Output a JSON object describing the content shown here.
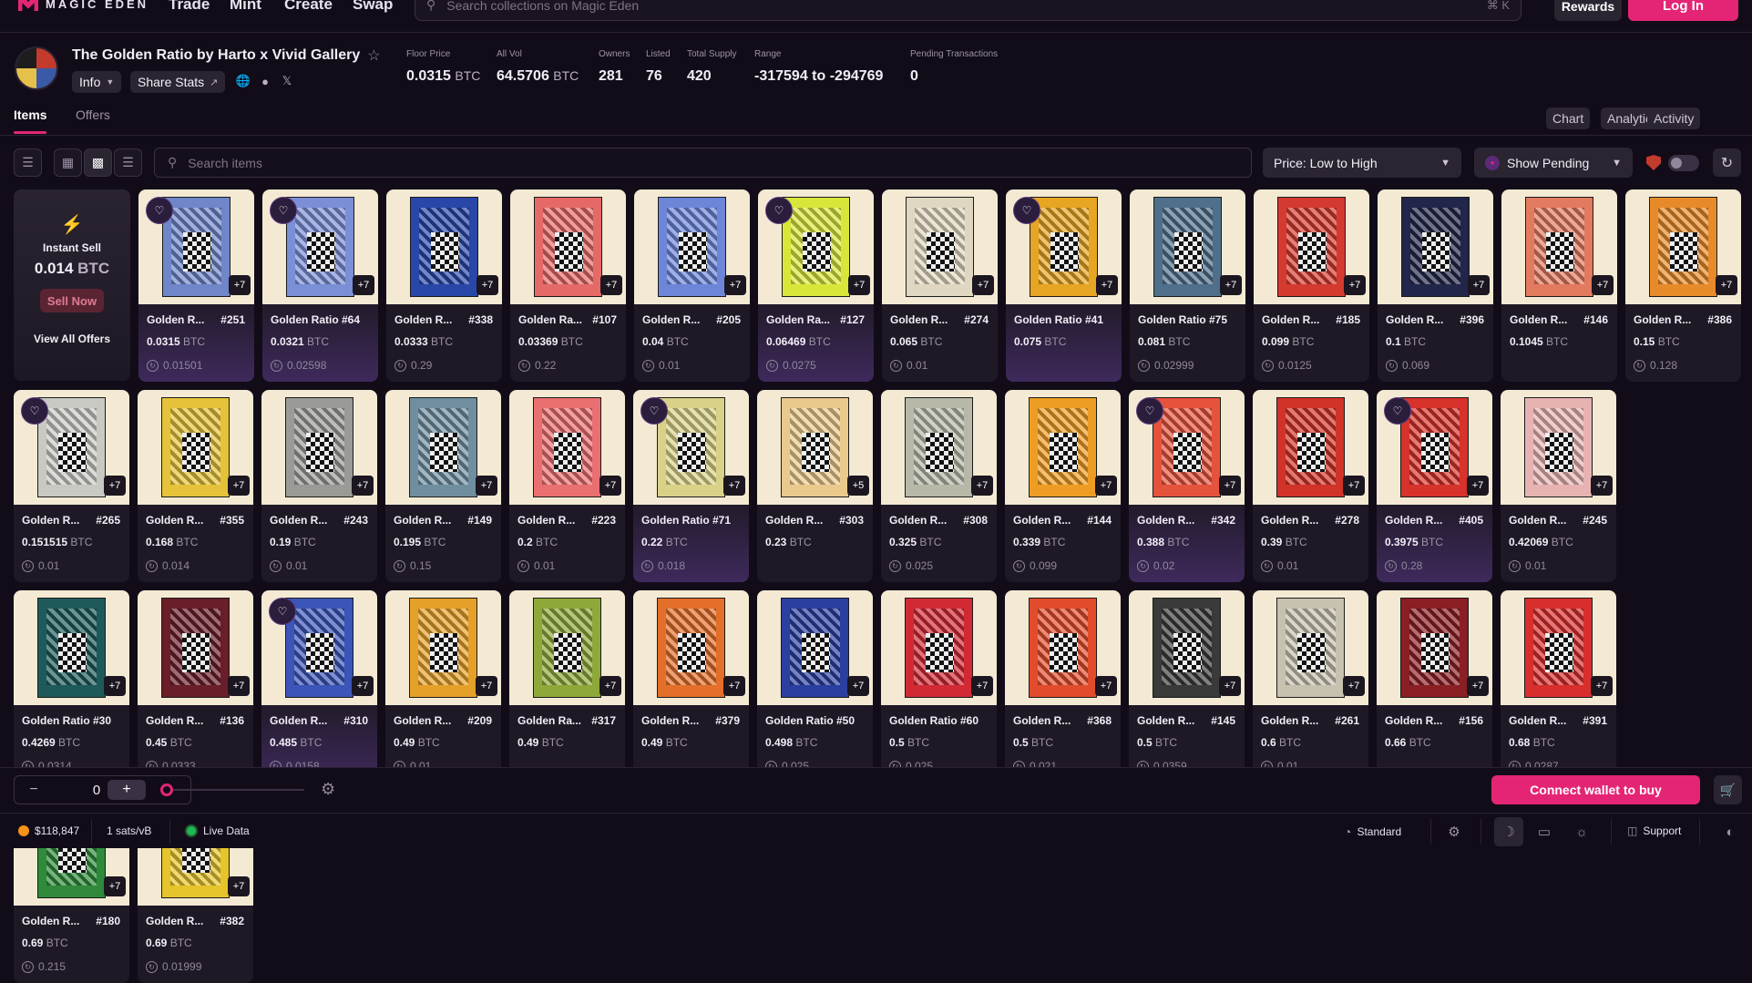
{
  "topnav": {
    "logo": "MAGIC EDEN",
    "links": [
      "Trade",
      "Mint",
      "Create",
      "Swap"
    ],
    "search_placeholder": "Search collections on Magic Eden",
    "search_shortcut": "⌘ K",
    "rewards": "Rewards",
    "login": "Log In"
  },
  "collection": {
    "title": "The Golden Ratio by Harto x Vivid Gallery",
    "info": "Info",
    "share_stats": "Share Stats",
    "stats": [
      {
        "label": "Floor Price",
        "value": "0.0315",
        "unit": "BTC"
      },
      {
        "label": "All Vol",
        "value": "64.5706",
        "unit": "BTC"
      },
      {
        "label": "Owners",
        "value": "281",
        "unit": ""
      },
      {
        "label": "Listed",
        "value": "76",
        "unit": ""
      },
      {
        "label": "Total Supply",
        "value": "420",
        "unit": ""
      },
      {
        "label": "Range",
        "value": "-317594 to -294769",
        "unit": ""
      },
      {
        "label": "Pending Transactions",
        "value": "0",
        "unit": ""
      }
    ]
  },
  "tabs": {
    "items": "Items",
    "offers": "Offers",
    "chart": "Chart",
    "analytics": "Analytics",
    "activity": "Activity"
  },
  "toolbar": {
    "search_placeholder": "Search items",
    "sort": "Price: Low to High",
    "pending": "Show Pending"
  },
  "instant_sell": {
    "title": "Instant Sell",
    "value": "0.014",
    "unit": "BTC",
    "sell_now": "Sell Now",
    "view_all": "View All Offers"
  },
  "cards": [
    {
      "name": "Golden R...",
      "num": "#251",
      "price": "0.0315",
      "last": "0.01501",
      "plus": "+7",
      "fav": true,
      "sel": true,
      "c": "#6f86c9"
    },
    {
      "name": "Golden Ratio #64",
      "num": "",
      "price": "0.0321",
      "last": "0.02598",
      "plus": "+7",
      "fav": true,
      "sel": true,
      "c": "#7b8fd6"
    },
    {
      "name": "Golden R...",
      "num": "#338",
      "price": "0.0333",
      "last": "0.29",
      "plus": "+7",
      "fav": false,
      "sel": false,
      "c": "#2847a8"
    },
    {
      "name": "Golden Ra...",
      "num": "#107",
      "price": "0.03369",
      "last": "0.22",
      "plus": "+7",
      "fav": false,
      "sel": false,
      "c": "#e56a67"
    },
    {
      "name": "Golden R...",
      "num": "#205",
      "price": "0.04",
      "last": "0.01",
      "plus": "+7",
      "fav": false,
      "sel": false,
      "c": "#6d86d8"
    },
    {
      "name": "Golden Ra...",
      "num": "#127",
      "price": "0.06469",
      "last": "0.0275",
      "plus": "+7",
      "fav": true,
      "sel": true,
      "c": "#d8e63a"
    },
    {
      "name": "Golden R...",
      "num": "#274",
      "price": "0.065",
      "last": "0.01",
      "plus": "+7",
      "fav": false,
      "sel": false,
      "c": "#e0d7c0"
    },
    {
      "name": "Golden Ratio #41",
      "num": "",
      "price": "0.075",
      "last": "",
      "plus": "+7",
      "fav": true,
      "sel": true,
      "c": "#e6a522"
    },
    {
      "name": "Golden Ratio #75",
      "num": "",
      "price": "0.081",
      "last": "0.02999",
      "plus": "+7",
      "fav": false,
      "sel": false,
      "c": "#4f6f8a"
    },
    {
      "name": "Golden R...",
      "num": "#185",
      "price": "0.099",
      "last": "0.0125",
      "plus": "+7",
      "fav": false,
      "sel": false,
      "c": "#d43a2f"
    },
    {
      "name": "Golden R...",
      "num": "#396",
      "price": "0.1",
      "last": "0.069",
      "plus": "+7",
      "fav": false,
      "sel": false,
      "c": "#22264a"
    },
    {
      "name": "Golden R...",
      "num": "#146",
      "price": "0.1045",
      "last": "",
      "plus": "+7",
      "fav": false,
      "sel": false,
      "c": "#e27a5f"
    },
    {
      "name": "Golden R...",
      "num": "#386",
      "price": "0.15",
      "last": "0.128",
      "plus": "+7",
      "fav": false,
      "sel": false,
      "c": "#e78b2a"
    },
    {
      "name": "Golden R...",
      "num": "#265",
      "price": "0.151515",
      "last": "0.01",
      "plus": "+7",
      "fav": true,
      "sel": false,
      "c": "#c9c9c4"
    },
    {
      "name": "Golden R...",
      "num": "#355",
      "price": "0.168",
      "last": "0.014",
      "plus": "+7",
      "fav": false,
      "sel": false,
      "c": "#e5c23a"
    },
    {
      "name": "Golden R...",
      "num": "#243",
      "price": "0.19",
      "last": "0.01",
      "plus": "+7",
      "fav": false,
      "sel": false,
      "c": "#9a9a96"
    },
    {
      "name": "Golden R...",
      "num": "#149",
      "price": "0.195",
      "last": "0.15",
      "plus": "+7",
      "fav": false,
      "sel": false,
      "c": "#6f8fa0"
    },
    {
      "name": "Golden R...",
      "num": "#223",
      "price": "0.2",
      "last": "0.01",
      "plus": "+7",
      "fav": false,
      "sel": false,
      "c": "#ea6f70"
    },
    {
      "name": "Golden Ratio #71",
      "num": "",
      "price": "0.22",
      "last": "0.018",
      "plus": "+7",
      "fav": true,
      "sel": true,
      "c": "#d9d187"
    },
    {
      "name": "Golden R...",
      "num": "#303",
      "price": "0.23",
      "last": "",
      "plus": "+5",
      "fav": false,
      "sel": false,
      "c": "#eac98c"
    },
    {
      "name": "Golden R...",
      "num": "#308",
      "price": "0.325",
      "last": "0.025",
      "plus": "+7",
      "fav": false,
      "sel": false,
      "c": "#b7b8a8"
    },
    {
      "name": "Golden R...",
      "num": "#144",
      "price": "0.339",
      "last": "0.099",
      "plus": "+7",
      "fav": false,
      "sel": false,
      "c": "#ee9d24"
    },
    {
      "name": "Golden R...",
      "num": "#342",
      "price": "0.388",
      "last": "0.02",
      "plus": "+7",
      "fav": true,
      "sel": true,
      "c": "#e6533d"
    },
    {
      "name": "Golden R...",
      "num": "#278",
      "price": "0.39",
      "last": "0.01",
      "plus": "+7",
      "fav": false,
      "sel": false,
      "c": "#d13328"
    },
    {
      "name": "Golden R...",
      "num": "#405",
      "price": "0.3975",
      "last": "0.28",
      "plus": "+7",
      "fav": true,
      "sel": true,
      "c": "#d7322b"
    },
    {
      "name": "Golden R...",
      "num": "#245",
      "price": "0.42069",
      "last": "0.01",
      "plus": "+7",
      "fav": false,
      "sel": false,
      "c": "#e7b3b2"
    },
    {
      "name": "Golden Ratio #30",
      "num": "",
      "price": "0.4269",
      "last": "0.0314",
      "plus": "+7",
      "fav": false,
      "sel": false,
      "c": "#1f5a5a"
    },
    {
      "name": "Golden R...",
      "num": "#136",
      "price": "0.45",
      "last": "0.0333",
      "plus": "+7",
      "fav": false,
      "sel": false,
      "c": "#6a1e2a"
    },
    {
      "name": "Golden R...",
      "num": "#310",
      "price": "0.485",
      "last": "0.0158",
      "plus": "+7",
      "fav": true,
      "sel": true,
      "c": "#3b55b8"
    },
    {
      "name": "Golden R...",
      "num": "#209",
      "price": "0.49",
      "last": "0.01",
      "plus": "+7",
      "fav": false,
      "sel": false,
      "c": "#e5a029"
    },
    {
      "name": "Golden Ra...",
      "num": "#317",
      "price": "0.49",
      "last": "",
      "plus": "+7",
      "fav": false,
      "sel": false,
      "c": "#8fa83a"
    },
    {
      "name": "Golden R...",
      "num": "#379",
      "price": "0.49",
      "last": "",
      "plus": "+7",
      "fav": false,
      "sel": false,
      "c": "#e36f2a"
    },
    {
      "name": "Golden Ratio #50",
      "num": "",
      "price": "0.498",
      "last": "0.025",
      "plus": "+7",
      "fav": false,
      "sel": false,
      "c": "#2b3fa0"
    },
    {
      "name": "Golden Ratio #60",
      "num": "",
      "price": "0.5",
      "last": "0.025",
      "plus": "+7",
      "fav": false,
      "sel": false,
      "c": "#d12a35"
    },
    {
      "name": "Golden R...",
      "num": "#368",
      "price": "0.5",
      "last": "0.021",
      "plus": "+7",
      "fav": false,
      "sel": false,
      "c": "#e24c2c"
    },
    {
      "name": "Golden R...",
      "num": "#145",
      "price": "0.5",
      "last": "0.0359",
      "plus": "+7",
      "fav": false,
      "sel": false,
      "c": "#3a3a3a"
    },
    {
      "name": "Golden R...",
      "num": "#261",
      "price": "0.6",
      "last": "0.01",
      "plus": "+7",
      "fav": false,
      "sel": false,
      "c": "#c7c1b0"
    },
    {
      "name": "Golden R...",
      "num": "#156",
      "price": "0.66",
      "last": "",
      "plus": "+7",
      "fav": false,
      "sel": false,
      "c": "#8a1f24"
    },
    {
      "name": "Golden R...",
      "num": "#391",
      "price": "0.68",
      "last": "0.0287",
      "plus": "+7",
      "fav": false,
      "sel": false,
      "c": "#d92e2e"
    },
    {
      "name": "Golden R...",
      "num": "#180",
      "price": "0.69",
      "last": "0.215",
      "plus": "+7",
      "fav": false,
      "sel": false,
      "c": "#2f8a3b"
    },
    {
      "name": "Golden R...",
      "num": "#382",
      "price": "0.69",
      "last": "0.01999",
      "plus": "+7",
      "fav": false,
      "sel": false,
      "c": "#e6c42c"
    }
  ],
  "currency": "BTC",
  "footer": {
    "qty": "0",
    "connect": "Connect wallet to buy",
    "btc_price": "$118,847",
    "fee": "1 sats/vB",
    "live": "Live Data",
    "mode": "Standard",
    "support": "Support"
  }
}
